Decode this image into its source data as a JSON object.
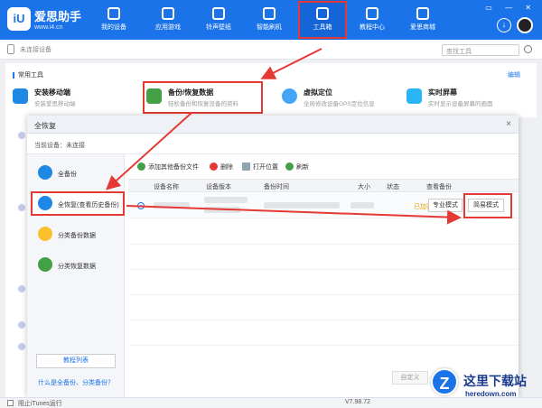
{
  "app": {
    "brand": "爱思助手",
    "url": "www.i4.cn"
  },
  "nav": [
    {
      "label": "我的设备",
      "icon": "phone-icon"
    },
    {
      "label": "应用游戏",
      "icon": "appstore-icon"
    },
    {
      "label": "铃声壁纸",
      "icon": "music-icon"
    },
    {
      "label": "智能刷机",
      "icon": "refresh-icon"
    },
    {
      "label": "工具箱",
      "icon": "toolbox-icon",
      "active": true
    },
    {
      "label": "教程中心",
      "icon": "graduation-icon"
    },
    {
      "label": "爱思商城",
      "icon": "store-icon"
    }
  ],
  "device_bar": {
    "status": "未连接设备",
    "search_placeholder": "查找工具"
  },
  "tools_section": {
    "title": "常用工具",
    "edit": "编辑",
    "tools": [
      {
        "name": "安装移动端",
        "desc": "安装爱思移动端"
      },
      {
        "name": "备份/恢复数据",
        "desc": "轻松备份和恢复设备的资料"
      },
      {
        "name": "虚拟定位",
        "desc": "全局修改设备GPS定位信息"
      },
      {
        "name": "实时屏幕",
        "desc": "实时显示设备屏幕的画面"
      }
    ]
  },
  "dialog": {
    "title": "全恢复",
    "close": "×",
    "current_device": "当前设备：未连接",
    "sidebar": [
      {
        "label": "全备份"
      },
      {
        "label": "全恢复(查看历史备份)",
        "active": true
      },
      {
        "label": "分类备份数据"
      },
      {
        "label": "分类恢复数据"
      }
    ],
    "sidebar_button": "教程列表",
    "sidebar_link": "什么是全备份、分类备份？",
    "toolbar": {
      "add": "添加其他备份文件",
      "delete": "删除",
      "open": "打开位置",
      "refresh": "刷新"
    },
    "columns": [
      "设备名称",
      "设备版本",
      "备份时间",
      "大小",
      "状态",
      "查看备份"
    ],
    "row": {
      "status": "已加密",
      "pro_mode": "专业模式",
      "simple_mode": "简易模式"
    },
    "footer_button": "自定义"
  },
  "statusbar": {
    "itunes": "阻止iTunes运行",
    "version": "V7.98.72"
  },
  "watermark": {
    "line1": "这里下载站",
    "line2": "heredown.com"
  },
  "colors": {
    "brand": "#1a73e8",
    "highlight": "#e53935",
    "encrypted": "#e0a200"
  }
}
